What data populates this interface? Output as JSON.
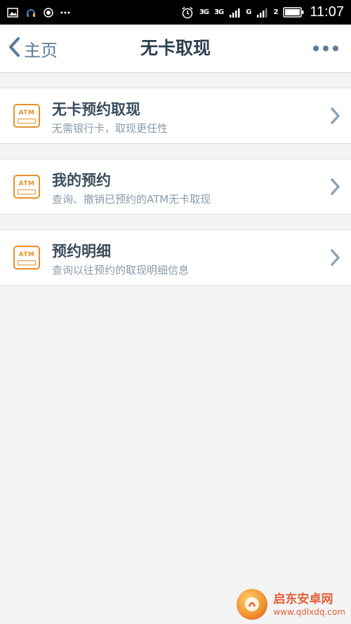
{
  "status_bar": {
    "left_icons": [
      "image-icon",
      "headset-lock-icon",
      "record-icon",
      "more-dots-icon"
    ],
    "net1": "3G",
    "net2": "3G",
    "net3": "G",
    "sim2": "2",
    "time": "11:07"
  },
  "nav": {
    "back_label": "主页",
    "title": "无卡取现"
  },
  "items": [
    {
      "title": "无卡预约取现",
      "subtitle": "无需银行卡，取现更任性",
      "icon_text": "ATM"
    },
    {
      "title": "我的预约",
      "subtitle": "查询、撤销已预约的ATM无卡取现",
      "icon_text": "ATM"
    },
    {
      "title": "预约明细",
      "subtitle": "查询以往预约的取现明细信息",
      "icon_text": "ATM"
    }
  ],
  "watermark": {
    "name": "启东安卓网",
    "url": "www.qdlxdq.com"
  },
  "colors": {
    "accent": "#5b7a99",
    "atm_orange": "#e88f2a",
    "title_text": "#2d3e50",
    "subtitle_text": "#8a9aaa"
  }
}
